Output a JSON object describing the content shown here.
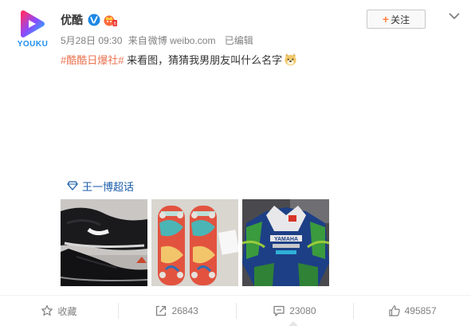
{
  "account": {
    "name": "优酷",
    "logo_text": "YOUKU",
    "verified_icon": "verified-v-icon",
    "vip_icon": "vip-crown-icon"
  },
  "meta": {
    "timestamp": "5月28日 09:30",
    "source_prefix": "来自",
    "source": "微博 weibo.com",
    "edited": "已编辑"
  },
  "follow_button": {
    "plus": "+",
    "label": "关注"
  },
  "post": {
    "hashtag": "#酷酷日爆社#",
    "text": " 来看图，猜猜我男朋友叫什么名字",
    "emoji": "doge-emoji"
  },
  "super_topic": {
    "label": "王一博超话",
    "icon": "diamond-icon"
  },
  "photos": [
    {
      "icon": "sneakers-photo"
    },
    {
      "icon": "skateboards-photo"
    },
    {
      "icon": "yamaha-racing-suit-photo"
    }
  ],
  "actions": {
    "favorite": "收藏",
    "repost": "26843",
    "comment": "23080",
    "like": "495857"
  },
  "colors": {
    "hashtag": "#eb7350",
    "super_topic": "#1a5ca8",
    "follow_plus": "#ff8140",
    "brand_blue": "#1f8ff0",
    "brand_pink": "#ff2d6f"
  }
}
